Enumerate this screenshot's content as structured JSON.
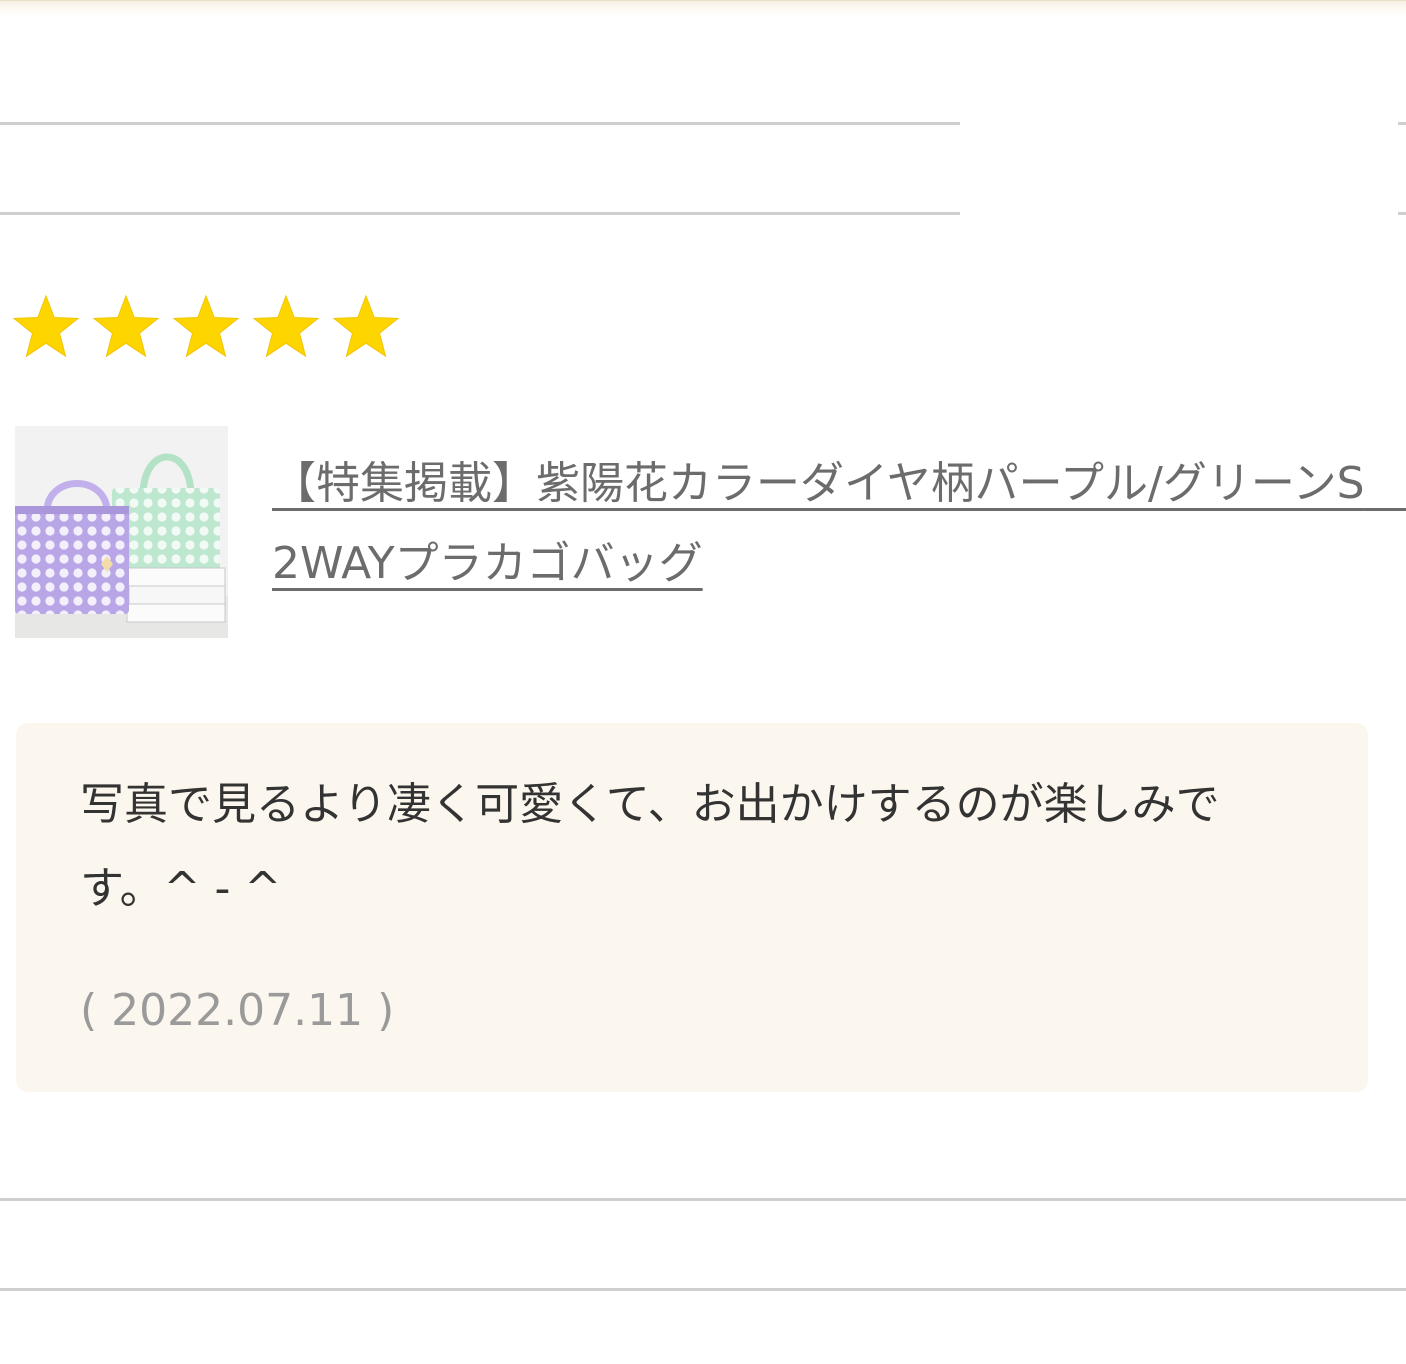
{
  "rating": {
    "value": 5,
    "max": 5,
    "star_color": "#ffd500"
  },
  "product": {
    "thumbnail_icon": "product-photo-tote-bags",
    "title": "【特集掲載】紫陽花カラーダイヤ柄パープル/グリーンS　　2WAYプラカゴバッグ"
  },
  "review": {
    "text": "写真で見るより凄く可愛くて、お出かけするのが楽しみです。^ - ^",
    "date": "( 2022.07.11 )"
  },
  "colors": {
    "review_background": "#fcf7ee",
    "divider": "#cfcfcf",
    "link_text": "#6c6c6c",
    "date_text": "#9a9a9a"
  }
}
